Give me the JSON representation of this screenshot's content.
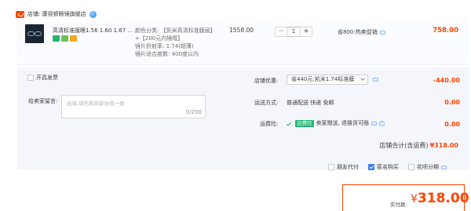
{
  "shop": {
    "label": "店铺: 康视顿眼镜旗舰店",
    "badge_icon": "shop-icon",
    "status_icon": "blue-bubble-icon"
  },
  "item": {
    "title": "高清标准膜眼1.56 1.60 1.67 ...",
    "spec_lines": [
      "颜色分类: 【凯米高清标准膜层】",
      "+【200元内镜框】",
      "镜片折射率: 1.74(超薄)",
      "镜片适合度数: 400度以内"
    ],
    "unit_price": "1558.00",
    "quantity": "1",
    "qty_minus": "−",
    "qty_plus": "+",
    "promo": "省800:热卖促销",
    "subtotal": "758.00"
  },
  "invoice": {
    "label": "开具发票"
  },
  "message": {
    "label": "给卖家留言:",
    "placeholder": "选填,请先和商家协商一致",
    "counter": "0/200"
  },
  "shop_coupon": {
    "label": "店铺优惠:",
    "selected": "省440元:凯米1.74标准膜",
    "amount": "-440.00"
  },
  "delivery": {
    "label": "运送方式:",
    "value": "普通配送 快递 免邮",
    "amount": "0.00"
  },
  "insurance": {
    "label": "运费险:",
    "badge": "运费险",
    "desc": "卖家赠送, 退换货可赔",
    "amount": "0.00"
  },
  "shop_total": {
    "label": "店铺合计(含运费)",
    "value": "¥318.00"
  },
  "options": {
    "friend_pay": "朋友代付",
    "anonymous": "匿名购买",
    "installment": "花呗分期"
  },
  "actual_pay": {
    "label": "实付款:",
    "yen": "¥",
    "value": "318.00"
  },
  "colors": {
    "accent_red": "#ff4400",
    "blue": "#3b7cf2",
    "green": "#22b573"
  }
}
